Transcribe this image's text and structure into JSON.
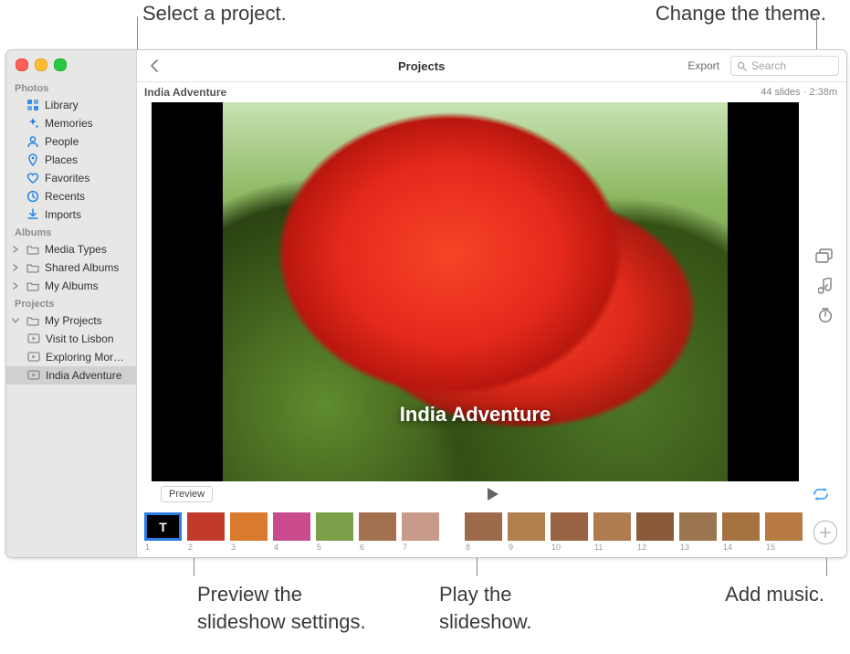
{
  "callouts": {
    "select_project": "Select a project.",
    "change_theme": "Change the theme.",
    "preview_settings": "Preview the\nslideshow settings.",
    "play_slideshow": "Play the\nslideshow.",
    "add_music": "Add music."
  },
  "toolbar": {
    "title": "Projects",
    "export": "Export",
    "search_placeholder": "Search"
  },
  "project": {
    "name": "India Adventure",
    "info": "44 slides · 2:38m",
    "overlay_title": "India Adventure"
  },
  "controls": {
    "preview": "Preview"
  },
  "sidebar": {
    "sections": [
      {
        "header": "Photos",
        "items": [
          {
            "icon": "photos",
            "label": "Library"
          },
          {
            "icon": "sparkles",
            "label": "Memories"
          },
          {
            "icon": "person",
            "label": "People"
          },
          {
            "icon": "pin",
            "label": "Places"
          },
          {
            "icon": "heart",
            "label": "Favorites"
          },
          {
            "icon": "clock",
            "label": "Recents"
          },
          {
            "icon": "download",
            "label": "Imports"
          }
        ]
      },
      {
        "header": "Albums",
        "items": [
          {
            "icon": "folder",
            "label": "Media Types",
            "chev": true
          },
          {
            "icon": "folder",
            "label": "Shared Albums",
            "chev": true
          },
          {
            "icon": "folder",
            "label": "My Albums",
            "chev": true
          }
        ]
      },
      {
        "header": "Projects",
        "items": [
          {
            "icon": "folder",
            "label": "My Projects",
            "chev": true,
            "expanded": true,
            "children": [
              {
                "icon": "slideshow",
                "label": "Visit to Lisbon"
              },
              {
                "icon": "slideshow",
                "label": "Exploring Mor…"
              },
              {
                "icon": "slideshow",
                "label": "India Adventure",
                "selected": true
              }
            ]
          }
        ]
      }
    ]
  },
  "thumbnails": {
    "title_slide_glyph": "T",
    "indices": [
      "1",
      "2",
      "3",
      "4",
      "5",
      "6",
      "7",
      "8",
      "9",
      "10",
      "11",
      "12",
      "13",
      "14",
      "15"
    ],
    "colors": [
      "#000",
      "#c23b2a",
      "#d97a2d",
      "#ca4b8d",
      "#7aa04a",
      "#a47150",
      "#c79a8a",
      "#9d6b4b",
      "#b27f4f",
      "#9a6344",
      "#af7c4f",
      "#8a5b3a",
      "#9b7450",
      "#a57140",
      "#b77b43"
    ]
  }
}
